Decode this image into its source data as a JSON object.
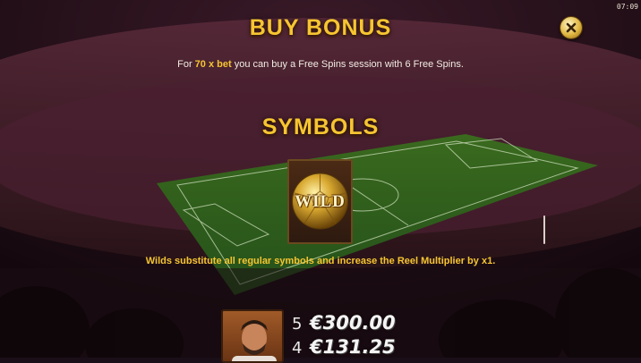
{
  "clock": "07:09",
  "buy_bonus": {
    "title": "BUY BONUS",
    "desc_prefix": "For ",
    "desc_highlight": "70 x bet",
    "desc_suffix": " you can buy a Free Spins session with 6 Free Spins."
  },
  "symbols": {
    "title": "SYMBOLS",
    "wild_label": "WILD",
    "wild_description": "Wilds substitute all regular symbols and increase the Reel Multiplier by x1."
  },
  "paytable": [
    {
      "count": "5",
      "amount": "€300.00"
    },
    {
      "count": "4",
      "amount": "€131.25"
    }
  ],
  "colors": {
    "accent_gold": "#f6c531",
    "text": "#f2ece4"
  },
  "icons": {
    "close": "close-icon",
    "wild": "golden-football-icon",
    "player": "player-portrait"
  }
}
